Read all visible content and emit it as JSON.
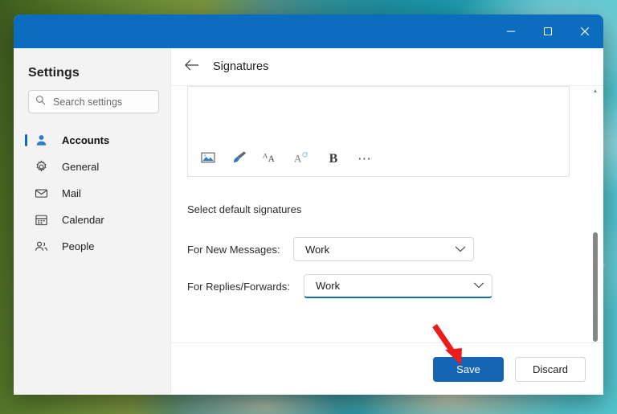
{
  "window": {
    "titlebar_color": "#0c6cbe",
    "controls": [
      {
        "name": "minimize",
        "glyph": "minimize-icon"
      },
      {
        "name": "maximize",
        "glyph": "maximize-icon"
      },
      {
        "name": "close",
        "glyph": "close-icon"
      }
    ]
  },
  "sidebar": {
    "title": "Settings",
    "search": {
      "placeholder": "Search settings",
      "value": "",
      "icon": "search-icon"
    },
    "items": [
      {
        "label": "Accounts",
        "icon": "person-icon",
        "selected": true
      },
      {
        "label": "General",
        "icon": "gear-icon",
        "selected": false
      },
      {
        "label": "Mail",
        "icon": "envelope-icon",
        "selected": false
      },
      {
        "label": "Calendar",
        "icon": "calendar-icon",
        "selected": false
      },
      {
        "label": "People",
        "icon": "people-icon",
        "selected": false
      }
    ]
  },
  "content": {
    "back_icon": "back-arrow-icon",
    "title": "Signatures",
    "editor": {
      "value": "",
      "toolbar": [
        {
          "name": "insert-picture",
          "icon": "picture-icon",
          "label": ""
        },
        {
          "name": "format-painter",
          "icon": "paintbrush-icon",
          "label": ""
        },
        {
          "name": "font-size",
          "icon": "font-size-icon",
          "label": ""
        },
        {
          "name": "clear-formatting",
          "icon": "clear-formatting-icon",
          "label": ""
        },
        {
          "name": "bold",
          "icon": "bold-icon",
          "label": "B"
        },
        {
          "name": "more-options",
          "icon": "ellipsis-icon",
          "label": "⋯"
        }
      ]
    },
    "section_label": "Select default signatures",
    "fields": [
      {
        "label": "For New Messages:",
        "value": "Work",
        "chevron": "chevron-down-icon",
        "focused": false
      },
      {
        "label": "For Replies/Forwards:",
        "value": "Work",
        "chevron": "chevron-down-icon",
        "focused": true
      }
    ],
    "scrollbar": {
      "up_glyph": "▲",
      "down_glyph": "▼"
    }
  },
  "footer": {
    "save_label": "Save",
    "discard_label": "Discard",
    "save_color": "#1565b5"
  },
  "annotation": {
    "type": "arrow",
    "color": "#ec1c1c",
    "points_to": "save-button"
  }
}
